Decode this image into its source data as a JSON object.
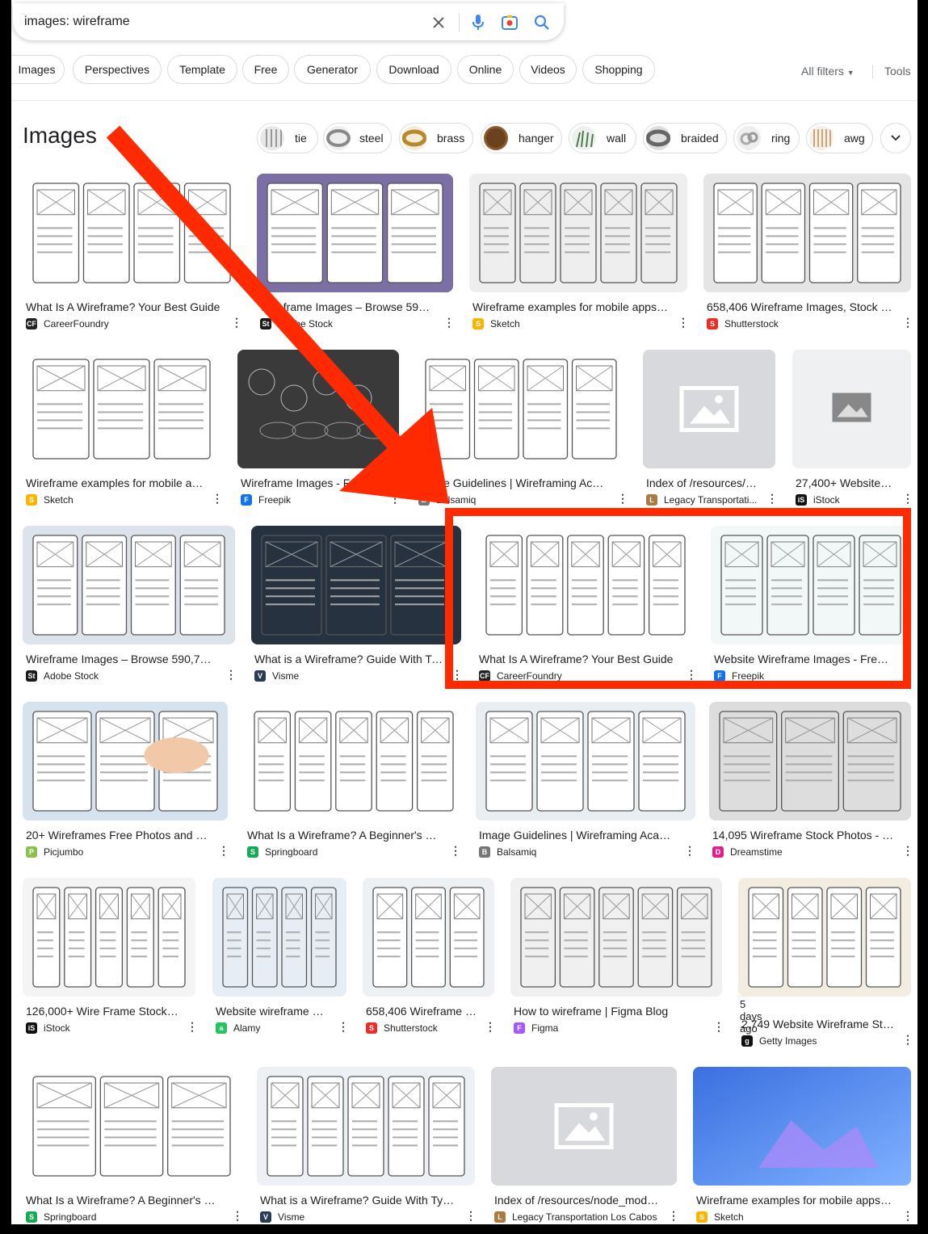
{
  "search": {
    "query": "images: wireframe"
  },
  "filter_chips": [
    "Images",
    "Perspectives",
    "Template",
    "Free",
    "Generator",
    "Download",
    "Online",
    "Videos",
    "Shopping"
  ],
  "toolbar": {
    "all_filters": "All filters",
    "tools": "Tools"
  },
  "section_title": "Images",
  "related_chips": [
    "tie",
    "steel",
    "brass",
    "hanger",
    "wall",
    "braided",
    "ring",
    "awg"
  ],
  "results": [
    {
      "title": "What Is A Wireframe? Your Best Guide",
      "source": "CareerFoundry",
      "fav": "CF"
    },
    {
      "title": "Wireframe Images – Browse 590,78...",
      "source": "Adobe Stock",
      "fav": "St"
    },
    {
      "title": "Wireframe examples for mobile apps an...",
      "source": "Sketch",
      "fav": "S"
    },
    {
      "title": "658,406 Wireframe Images, Stock Pho...",
      "source": "Shutterstock",
      "fav": "S"
    },
    {
      "title": "Wireframe examples for mobile app...",
      "source": "Sketch",
      "fav": "S"
    },
    {
      "title": "Wireframe Images - Free Do...",
      "source": "Freepik",
      "fav": "F"
    },
    {
      "title": "Image Guidelines | Wireframing Acade...",
      "source": "Balsamiq",
      "fav": "B"
    },
    {
      "title": "Index of /resources/no...",
      "source": "Legacy Transportati...",
      "fav": "L"
    },
    {
      "title": "27,400+ Website Wir...",
      "source": "iStock",
      "fav": "iS"
    },
    {
      "title": "Wireframe Images – Browse 590,787 S...",
      "source": "Adobe Stock",
      "fav": "St"
    },
    {
      "title": "What is a Wireframe? Guide With Types,...",
      "source": "Visme",
      "fav": "V"
    },
    {
      "title": "What Is A Wireframe? Your Best Guide",
      "source": "CareerFoundry",
      "fav": "CF"
    },
    {
      "title": "Website Wireframe Images - Free D...",
      "source": "Freepik",
      "fav": "F"
    },
    {
      "title": "20+ Wireframes Free Photos and Ima...",
      "source": "Picjumbo",
      "fav": "P"
    },
    {
      "title": "What Is a Wireframe? A Beginner's Guide",
      "source": "Springboard",
      "fav": "S"
    },
    {
      "title": "Image Guidelines | Wireframing Academ...",
      "source": "Balsamiq",
      "fav": "B"
    },
    {
      "title": "14,095 Wireframe Stock Photos - Fre...",
      "source": "Dreamstime",
      "fav": "D"
    },
    {
      "title": "126,000+ Wire Frame Stock Ph...",
      "source": "iStock",
      "fav": "iS"
    },
    {
      "title": "Website wireframe hi-r...",
      "source": "Alamy",
      "fav": "a"
    },
    {
      "title": "658,406 Wireframe Im...",
      "source": "Shutterstock",
      "fav": "S"
    },
    {
      "title": "How to wireframe | Figma Blog",
      "source": "Figma",
      "fav": "F"
    },
    {
      "title": "2,749 Website Wireframe Stock...",
      "source": "Getty Images",
      "fav": "g",
      "sub": "5 days ago"
    },
    {
      "title": "What Is a Wireframe? A Beginner's Guide",
      "source": "Springboard",
      "fav": "S"
    },
    {
      "title": "What is a Wireframe? Guide With Types,...",
      "source": "Visme",
      "fav": "V"
    },
    {
      "title": "Index of /resources/node_module...",
      "source": "Legacy Transportation Los Cabos",
      "fav": "L"
    },
    {
      "title": "Wireframe examples for mobile apps an...",
      "source": "Sketch",
      "fav": "S"
    }
  ],
  "colors": {
    "annotation": "#ff2a00",
    "frame": "#000000",
    "chip_border": "#dadce0"
  }
}
